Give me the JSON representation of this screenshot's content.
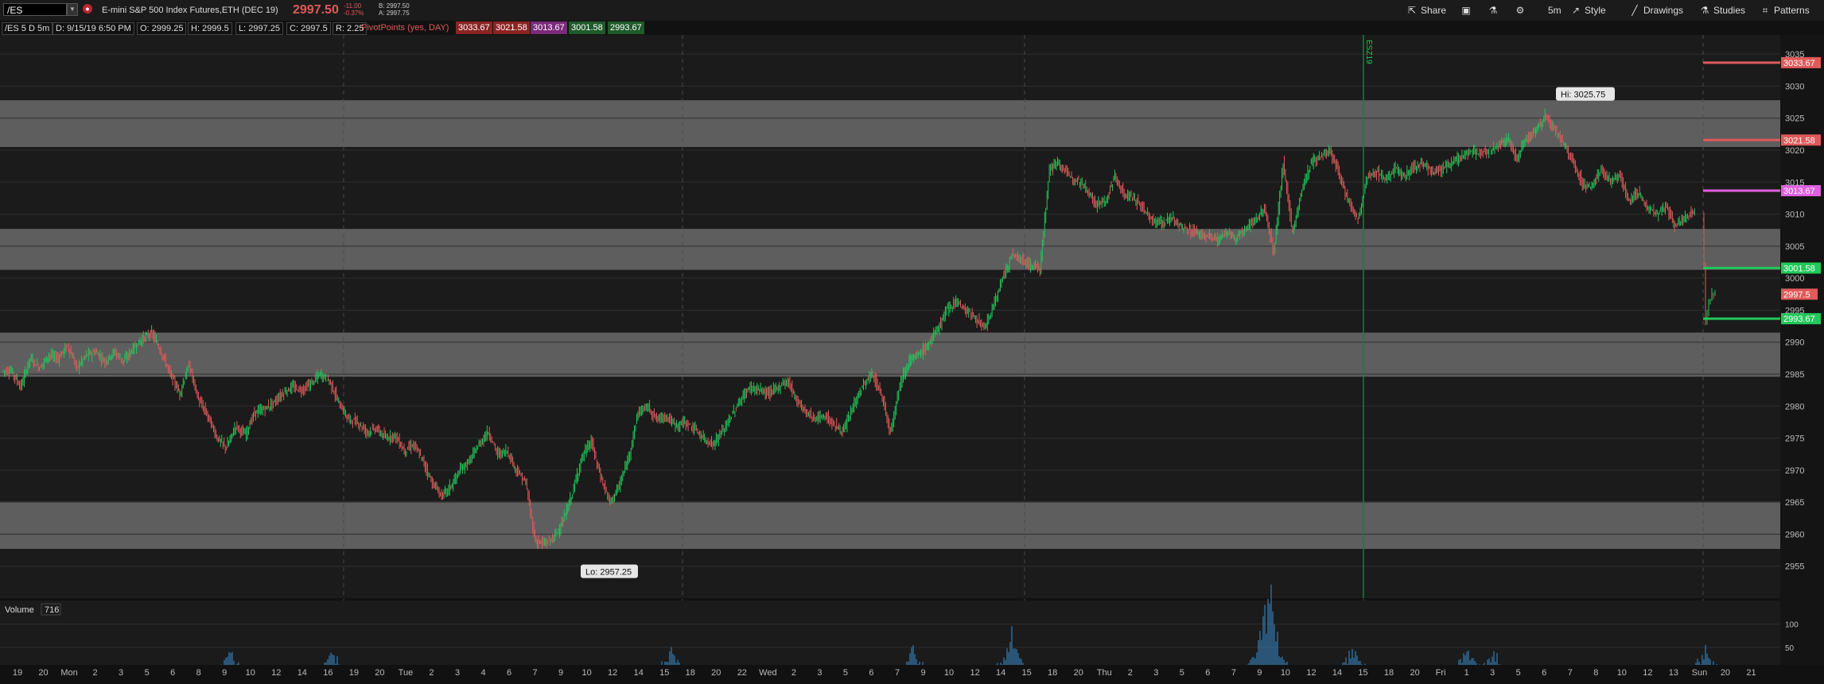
{
  "toolbar": {
    "symbol": "/ES",
    "description": "E-mini S&P 500 Index Futures,ETH (DEC 19)",
    "last_price": "2997.50",
    "net_change": "-11.00",
    "pct_change": "-0.37%",
    "bid": "B: 2997.50",
    "ask": "A: 2997.75",
    "share_label": "Share",
    "timeframe_label": "5m",
    "style_label": "Style",
    "drawings_label": "Drawings",
    "studies_label": "Studies",
    "patterns_label": "Patterns"
  },
  "infobar": {
    "chart_id": "/ES 5 D 5m",
    "date": "D: 9/15/19 6:50 PM",
    "open": "O: 2999.25",
    "high": "H: 2999.5",
    "low": "L: 2997.25",
    "close": "C: 2997.5",
    "range": "R: 2.25",
    "pivot_label": "PivotPoints (yes, DAY)",
    "pivot_values": [
      "3033.67",
      "3021.58",
      "3013.67",
      "3001.58",
      "2993.67"
    ]
  },
  "colors": {
    "up": "#22c85a",
    "down": "#e05a5a",
    "r_level": "#e05a5a",
    "pp_level": "#e060e0",
    "s_level": "#22c85a",
    "zone": "#6a6a6a",
    "background": "#1b1b1b"
  },
  "chart_data": {
    "type": "candlestick",
    "ylim": [
      2950,
      3038
    ],
    "y_ticks": [
      2955,
      2960,
      2965,
      2970,
      2975,
      2980,
      2985,
      2990,
      2995,
      3000,
      3005,
      3010,
      3015,
      3020,
      3025,
      3030,
      3035
    ],
    "x_tick_labels": [
      "19",
      "20",
      "Mon",
      "2",
      "3",
      "5",
      "6",
      "8",
      "9",
      "10",
      "12",
      "14",
      "16",
      "19",
      "20",
      "Tue",
      "2",
      "3",
      "4",
      "6",
      "7",
      "9",
      "10",
      "12",
      "14",
      "15",
      "18",
      "20",
      "22",
      "Wed",
      "2",
      "3",
      "5",
      "6",
      "7",
      "9",
      "10",
      "12",
      "14",
      "15",
      "18",
      "20",
      "Thu",
      "2",
      "3",
      "5",
      "6",
      "7",
      "9",
      "10",
      "12",
      "14",
      "15",
      "18",
      "20",
      "Fri",
      "1",
      "3",
      "5",
      "6",
      "7",
      "8",
      "10",
      "12",
      "13",
      "Sun",
      "20",
      "21"
    ],
    "annotations": [
      {
        "label": "Hi: 3025.75",
        "value": 3025.75
      },
      {
        "label": "Lo: 2957.25",
        "value": 2957.25
      },
      {
        "label": "ESZ19",
        "value": null
      }
    ],
    "zones": [
      {
        "from": 3020.5,
        "to": 3027.8
      },
      {
        "from": 3001.3,
        "to": 3007.7
      },
      {
        "from": 2984.6,
        "to": 2991.5
      },
      {
        "from": 2957.7,
        "to": 2965.1
      }
    ],
    "pivot_levels": [
      {
        "label": "3033.67",
        "value": 3033.67,
        "kind": "r"
      },
      {
        "label": "3021.58",
        "value": 3021.58,
        "kind": "r"
      },
      {
        "label": "3013.67",
        "value": 3013.67,
        "kind": "pp"
      },
      {
        "label": "3001.58",
        "value": 3001.58,
        "kind": "s"
      },
      {
        "label": "2993.67",
        "value": 2993.67,
        "kind": "s"
      }
    ],
    "price_path": [
      2985.5,
      2983,
      2987.5,
      2986,
      2988,
      2987.5,
      2989.5,
      2986,
      2988,
      2988.5,
      2987,
      2988.5,
      2987,
      2989,
      2990.5,
      2991.5,
      2988.5,
      2985,
      2982,
      2986.5,
      2981,
      2978.5,
      2975,
      2973.5,
      2977,
      2975.5,
      2979,
      2979.5,
      2980.5,
      2982,
      2983,
      2982.5,
      2983.5,
      2985,
      2984,
      2980.5,
      2978,
      2977.5,
      2976,
      2976.5,
      2975,
      2975.5,
      2973,
      2974,
      2971.5,
      2968,
      2966,
      2967.5,
      2970,
      2971.5,
      2974,
      2976,
      2972.5,
      2973,
      2970,
      2968,
      2959,
      2958.5,
      2959.5,
      2962,
      2966.5,
      2972,
      2974.5,
      2969,
      2965,
      2967.5,
      2972,
      2979,
      2980,
      2978,
      2978.5,
      2977,
      2977.5,
      2976.5,
      2975,
      2974,
      2976,
      2978.5,
      2981,
      2983,
      2982.5,
      2982,
      2983,
      2984,
      2981,
      2979,
      2978,
      2978.5,
      2977,
      2976,
      2980,
      2983,
      2985,
      2982,
      2976,
      2983.5,
      2987,
      2988,
      2989.5,
      2992,
      2995,
      2996.5,
      2995,
      2994,
      2992,
      2995.5,
      3000,
      3003.5,
      3003,
      3002,
      3001.5,
      3017,
      3018,
      3016,
      3015.5,
      3014,
      3011.5,
      3012,
      3016,
      3013,
      3012.5,
      3011,
      3009,
      3008.5,
      3009.5,
      3008,
      3007.5,
      3007,
      3006.5,
      3006,
      3007,
      3006,
      3008,
      3009,
      3011,
      3004,
      3018,
      3007,
      3014,
      3018,
      3019,
      3020,
      3016,
      3012,
      3009,
      3016,
      3016.5,
      3015.5,
      3017,
      3016,
      3017.5,
      3018,
      3016.5,
      3017,
      3018,
      3019,
      3020,
      3019.5,
      3020,
      3020.5,
      3022,
      3018.5,
      3022,
      3023,
      3025.5,
      3023,
      3021,
      3018,
      3015,
      3014,
      3017,
      3015,
      3016,
      3012,
      3013.5,
      3011,
      3010,
      3011,
      3008,
      3009.5,
      3010.5,
      2993,
      2996,
      2998,
      2997.5
    ],
    "volume": {
      "label": "Volume",
      "value": "716",
      "y_ticks": [
        50,
        100
      ]
    }
  }
}
